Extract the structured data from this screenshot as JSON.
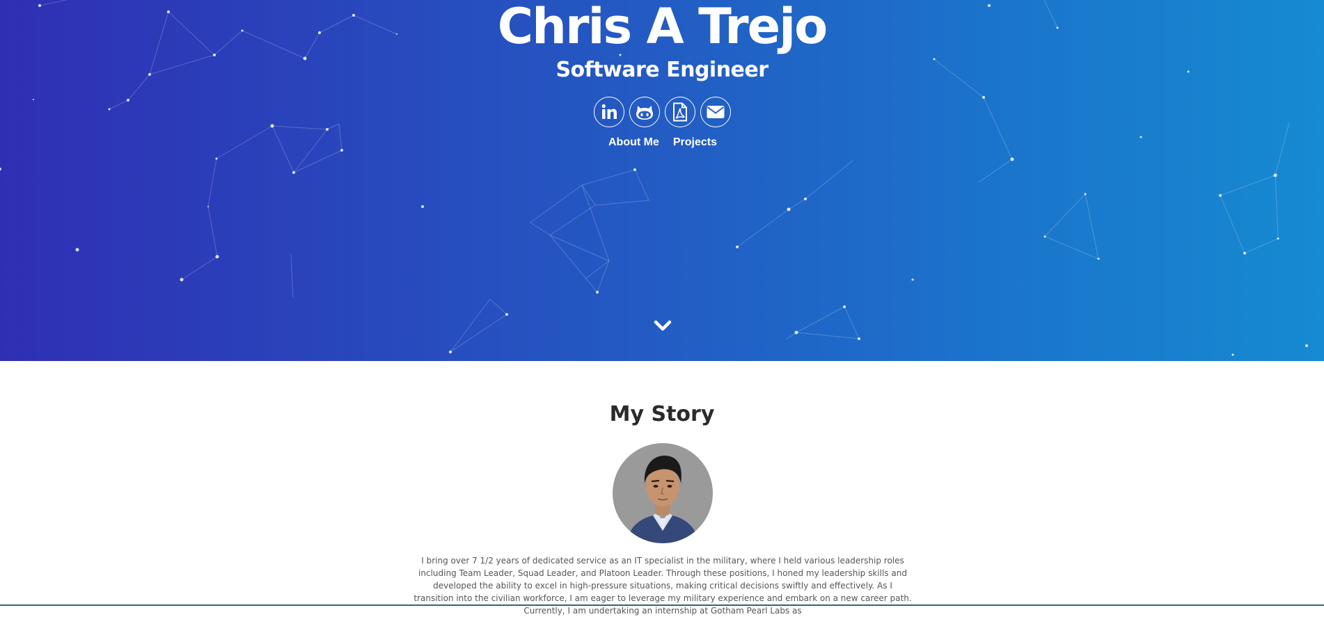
{
  "hero": {
    "name": "Chris A Trejo",
    "title": "Software Engineer",
    "social": [
      {
        "icon": "linkedin-icon"
      },
      {
        "icon": "github-icon"
      },
      {
        "icon": "pdf-resume-icon"
      },
      {
        "icon": "envelope-icon"
      }
    ],
    "nav": {
      "about": "About Me",
      "projects": "Projects"
    },
    "scroll_icon": "chevron-down-icon",
    "gradient_start": "#2f2fb4",
    "gradient_end": "#168ad2"
  },
  "story": {
    "heading": "My Story",
    "paragraph": "I bring over 7 1/2 years of dedicated service as an IT specialist in the military, where I held various leadership roles including Team Leader, Squad Leader, and Platoon Leader. Through these positions, I honed my leadership skills and developed the ability to excel in high-pressure situations, making critical decisions swiftly and effectively. As I transition into the civilian workforce, I am eager to leverage my military experience and embark on a new career path. Currently, I am undertaking an internship at Gotham Pearl Labs as"
  }
}
